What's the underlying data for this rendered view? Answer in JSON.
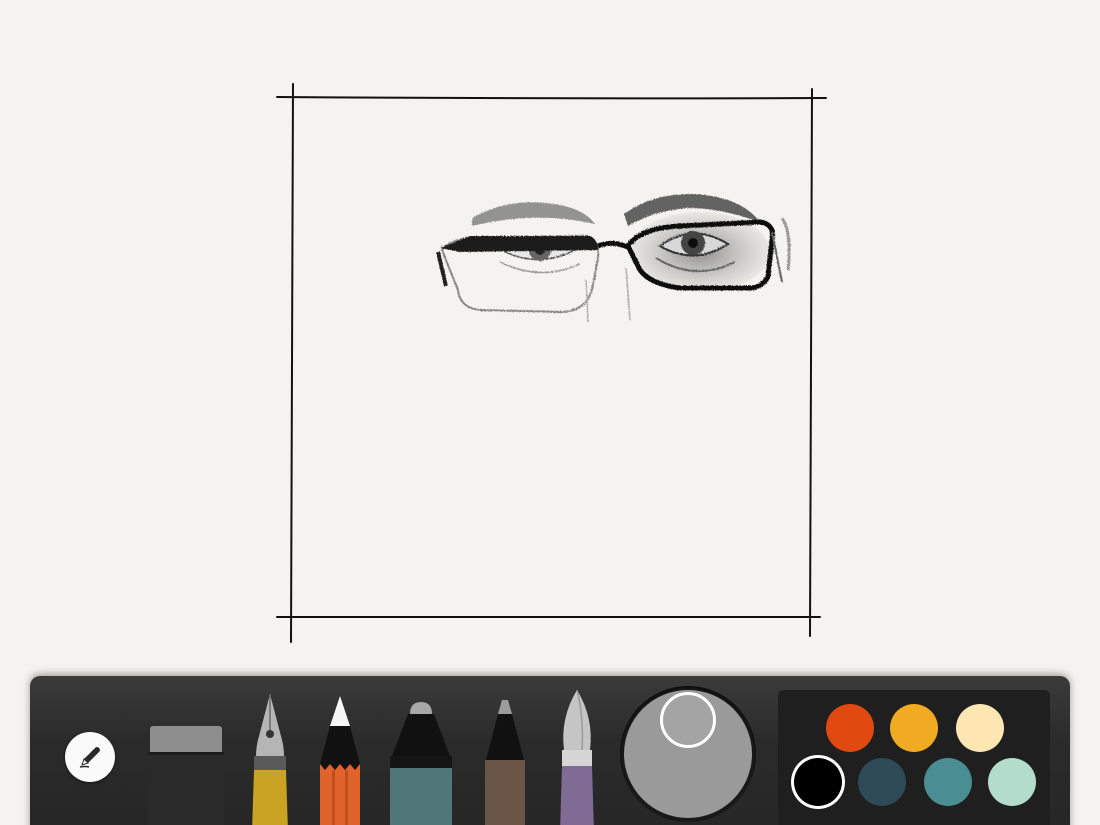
{
  "app": {
    "background_color": "#f4f3ef",
    "frame_color": "#111111"
  },
  "canvas": {
    "sketch": "eyes-with-glasses-sketch"
  },
  "toolbar": {
    "mode_icon": "pencil-icon",
    "tools": [
      {
        "name": "eraser",
        "icon": "eraser-icon",
        "body_color": "#2a2a2a",
        "tip_color": "#8e8e8e"
      },
      {
        "name": "fountain-pen",
        "icon": "fountain-pen-icon",
        "body_color": "#c9a321",
        "tip_color": "#b5b5b5"
      },
      {
        "name": "pencil",
        "icon": "pencil-tool-icon",
        "body_color": "#e0632c",
        "tip_color": "#111111",
        "selected": true
      },
      {
        "name": "marker",
        "icon": "marker-icon",
        "body_color": "#4f7679",
        "tip_color": "#a8a8a8"
      },
      {
        "name": "fineliner",
        "icon": "fineliner-icon",
        "body_color": "#6b5546",
        "tip_color": "#9c9c9c"
      },
      {
        "name": "brush",
        "icon": "brush-icon",
        "body_color": "#7f6b94",
        "tip_color": "#c5c5c5"
      }
    ],
    "brush_size_fraction": 0.45,
    "palette": [
      {
        "color": "#e04a10",
        "selected": false
      },
      {
        "color": "#f0ab22",
        "selected": false
      },
      {
        "color": "#fde6b2",
        "selected": false
      },
      {
        "color": "#000000",
        "selected": true
      },
      {
        "color": "#2f4a57",
        "selected": false
      },
      {
        "color": "#4a8e93",
        "selected": false
      },
      {
        "color": "#b3dccb",
        "selected": false
      }
    ]
  }
}
